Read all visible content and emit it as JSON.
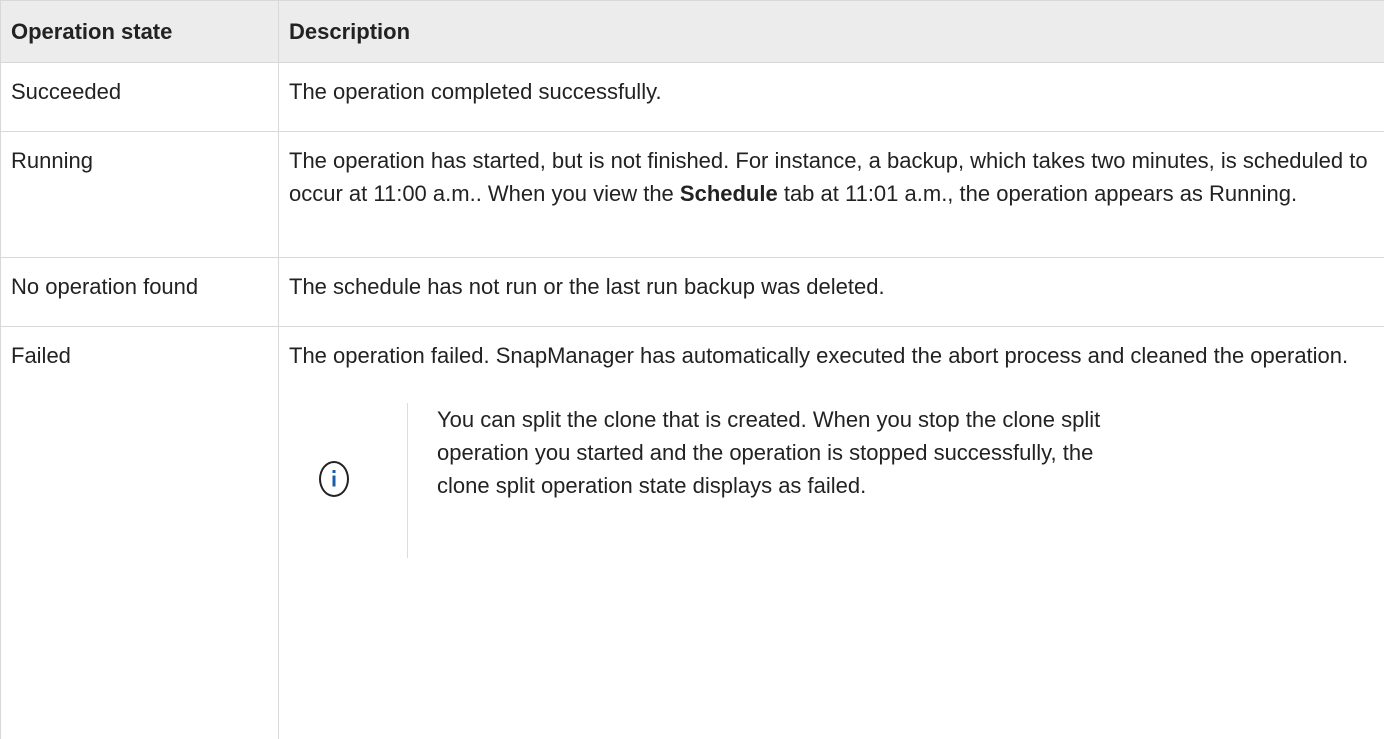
{
  "table": {
    "headers": {
      "state": "Operation state",
      "description": "Description"
    },
    "rows": [
      {
        "state": "Succeeded",
        "description": "The operation completed successfully."
      },
      {
        "state": "Running",
        "description_before": "The operation has started, but is not finished. For instance, a backup, which takes two minutes, is scheduled to occur at 11:00 a.m.. When you view the ",
        "description_bold": "Schedule",
        "description_after": " tab at 11:01 a.m., the operation appears as Running."
      },
      {
        "state": "No operation found",
        "description": "The schedule has not run or the last run backup was deleted."
      },
      {
        "state": "Failed",
        "description": "The operation failed. SnapManager has automatically executed the abort process and cleaned the operation.",
        "note": {
          "icon": "info-icon",
          "text": "You can split the clone that is created. When you stop the clone split operation you started and the operation is stopped successfully, the clone split operation state displays as failed."
        }
      }
    ]
  },
  "colors": {
    "header_background": "#ececec",
    "border": "#d8d8d8",
    "text": "#222222"
  }
}
